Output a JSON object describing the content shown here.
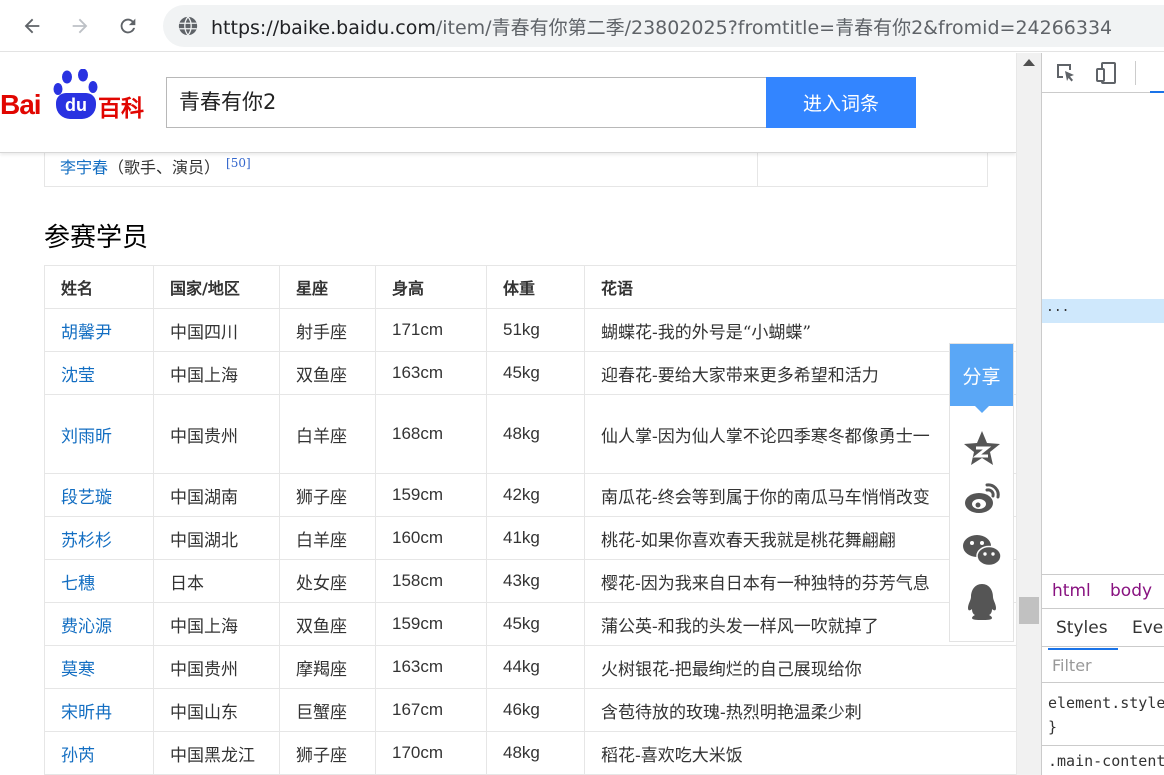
{
  "browser": {
    "url_host": "https://baike.baidu.com",
    "url_rest": "/item/青春有你第二季/23802025?fromtitle=青春有你2&fromid=24266334"
  },
  "header": {
    "logo_bai": "Bai",
    "logo_du": "du",
    "logo_baike": "百科",
    "search_value": "青春有你2",
    "search_button": "进入词条"
  },
  "prev_row": {
    "link": "李宇春",
    "role": "（歌手、演员）",
    "ref": "[50]"
  },
  "section_title": "参赛学员",
  "table": {
    "headers": [
      "姓名",
      "国家/地区",
      "星座",
      "身高",
      "体重",
      "花语"
    ],
    "rows": [
      {
        "name": "胡馨尹",
        "region": "中国四川",
        "sign": "射手座",
        "height": "171cm",
        "weight": "51kg",
        "flower": "蝴蝶花-我的外号是“小蝴蝶”"
      },
      {
        "name": "沈莹",
        "region": "中国上海",
        "sign": "双鱼座",
        "height": "163cm",
        "weight": "45kg",
        "flower": "迎春花-要给大家带来更多希望和活力"
      },
      {
        "name": "刘雨昕",
        "region": "中国贵州",
        "sign": "白羊座",
        "height": "168cm",
        "weight": "48kg",
        "flower": "仙人掌-因为仙人掌不论四季寒冬都像勇士一"
      },
      {
        "name": "段艺璇",
        "region": "中国湖南",
        "sign": "狮子座",
        "height": "159cm",
        "weight": "42kg",
        "flower": "南瓜花-终会等到属于你的南瓜马车悄悄改变"
      },
      {
        "name": "苏杉杉",
        "region": "中国湖北",
        "sign": "白羊座",
        "height": "160cm",
        "weight": "41kg",
        "flower": "桃花-如果你喜欢春天我就是桃花舞翩翩"
      },
      {
        "name": "七穗",
        "region": "日本",
        "sign": "处女座",
        "height": "158cm",
        "weight": "43kg",
        "flower": "樱花-因为我来自日本有一种独特的芬芳气息"
      },
      {
        "name": "费沁源",
        "region": "中国上海",
        "sign": "双鱼座",
        "height": "159cm",
        "weight": "45kg",
        "flower": "蒲公英-和我的头发一样风一吹就掉了"
      },
      {
        "name": "莫寒",
        "region": "中国贵州",
        "sign": "摩羯座",
        "height": "163cm",
        "weight": "44kg",
        "flower": "火树银花-把最绚烂的自己展现给你"
      },
      {
        "name": "宋昕冉",
        "region": "中国山东",
        "sign": "巨蟹座",
        "height": "167cm",
        "weight": "46kg",
        "flower": "含苞待放的玫瑰-热烈明艳温柔少刺"
      },
      {
        "name": "孙芮",
        "region": "中国黑龙江",
        "sign": "狮子座",
        "height": "170cm",
        "weight": "48kg",
        "flower": "稻花-喜欢吃大米饭"
      }
    ]
  },
  "share": {
    "label": "分享",
    "icons": [
      "qzone-icon",
      "weibo-icon",
      "wechat-icon",
      "qq-icon"
    ]
  },
  "devtools": {
    "selected_marker": "...",
    "crumb_html": "html",
    "crumb_body": "body",
    "tab_styles": "Styles",
    "tab_event": "Even",
    "filter_placeholder": "Filter",
    "code_line1": "element.style",
    "code_line2": "}",
    "code_line3": ".main-content"
  },
  "colors": {
    "link": "#136ec2",
    "search_button": "#3385ff",
    "share_head": "#5aa7f6",
    "logo_red": "#e10601",
    "logo_blue": "#2932e1"
  }
}
